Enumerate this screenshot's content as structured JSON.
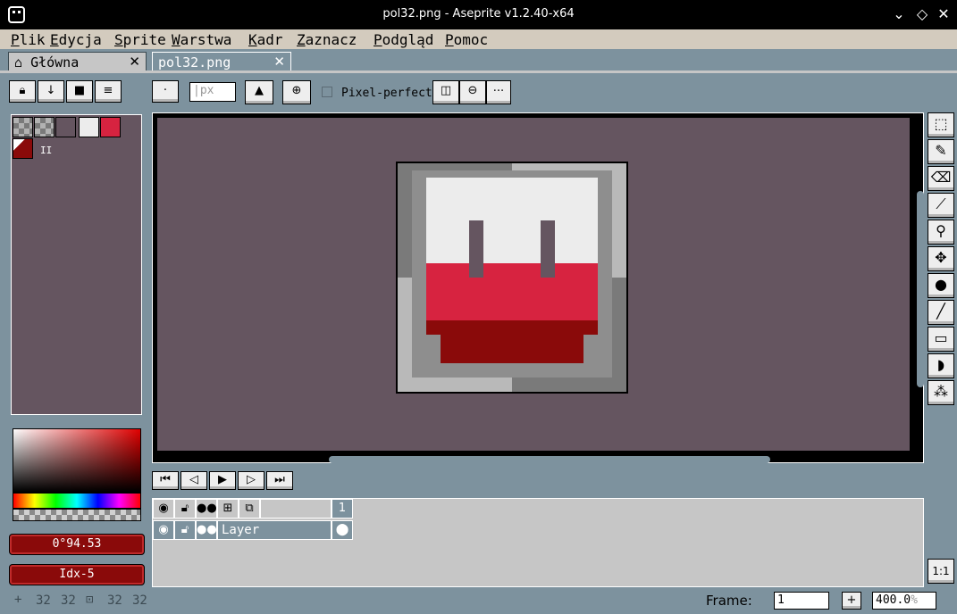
{
  "window": {
    "title": "pol32.png - Aseprite v1.2.40-x64",
    "minimize": "⌄",
    "maximize": "◇",
    "close": "✕"
  },
  "menu": [
    {
      "first": "P",
      "rest": "lik"
    },
    {
      "first": "E",
      "rest": "dycja"
    },
    {
      "first": "S",
      "rest": "prite"
    },
    {
      "first": "W",
      "rest": "arstwa"
    },
    {
      "first": "K",
      "rest": "adr"
    },
    {
      "first": "Z",
      "rest": "aznacz"
    },
    {
      "first": "P",
      "rest": "odgląd"
    },
    {
      "first": "P",
      "rest": "omoc"
    }
  ],
  "tabs": [
    {
      "label": "Główna",
      "close": "✕"
    },
    {
      "label": "pol32.png",
      "close": "✕"
    }
  ],
  "toolbar": {
    "brush_size_placeholder": "px",
    "pixel_perfect_label": "Pixel-perfect",
    "more_label": "..."
  },
  "palette": {
    "colors": [
      "#7a7a7a",
      "#b2b2b2",
      "#655560",
      "#ececec",
      "#d72340"
    ],
    "pause_glyph": "II"
  },
  "color_fields": {
    "hsv_value": "0°94.53",
    "index_value": "Idx-5"
  },
  "layers": {
    "frame_number": "1",
    "layer_name": "Layer"
  },
  "status": {
    "pos_x": "32",
    "pos_y": "32",
    "size_w": "32",
    "size_h": "32",
    "frame_label": "Frame:",
    "frame_value": "1",
    "add_frame": "+",
    "zoom_value": "400.0",
    "zoom_unit": "%",
    "one_to_one": "1:1"
  },
  "colors": {
    "canvas_bg": "#655560",
    "white": "#ececec",
    "red": "#d72340",
    "dark_red": "#8a0a0a",
    "accent": "#7d929e"
  }
}
